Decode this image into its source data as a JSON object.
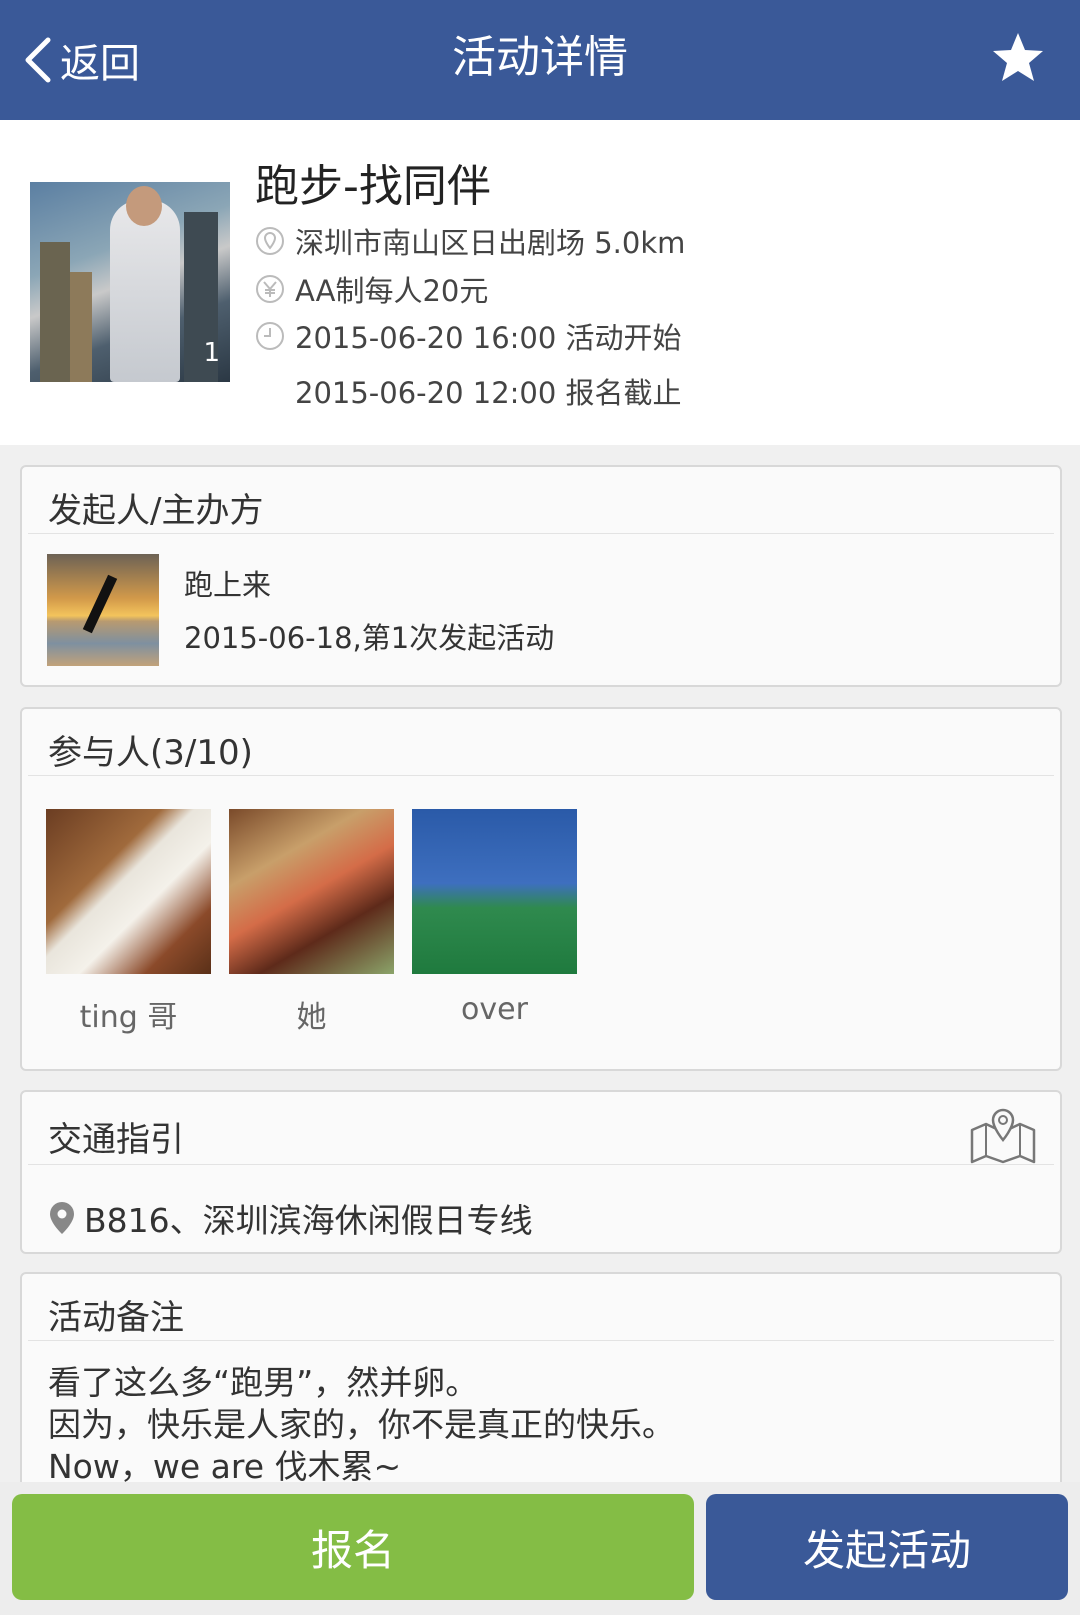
{
  "header": {
    "back_label": "返回",
    "title": "活动详情",
    "favorite_icon": "star-icon"
  },
  "activity": {
    "title": "跑步-找同伴",
    "cover_badge": "1",
    "location": "深圳市南山区日出剧场 5.0km",
    "fee": "AA制每人20元",
    "start_time": "2015-06-20 16:00 活动开始",
    "deadline": "2015-06-20 12:00 报名截止"
  },
  "organizer": {
    "section_title": "发起人/主办方",
    "name": "跑上来",
    "history": "2015-06-18,第1次发起活动"
  },
  "participants": {
    "section_title": "参与人(3/10)",
    "items": [
      {
        "name": "ting 哥"
      },
      {
        "name": "她"
      },
      {
        "name": "over"
      }
    ]
  },
  "traffic": {
    "section_title": "交通指引",
    "route": "B816、深圳滨海休闲假日专线"
  },
  "notes": {
    "section_title": "活动备注",
    "lines": [
      "看了这么多“跑男”，然并卵。",
      "因为，快乐是人家的，你不是真正的快乐。",
      "Now，we are 伐木累~"
    ]
  },
  "actions": {
    "signup_label": "报名",
    "launch_label": "发起活动"
  },
  "colors": {
    "brand_blue": "#3a5998",
    "signup_green": "#84bd45"
  }
}
